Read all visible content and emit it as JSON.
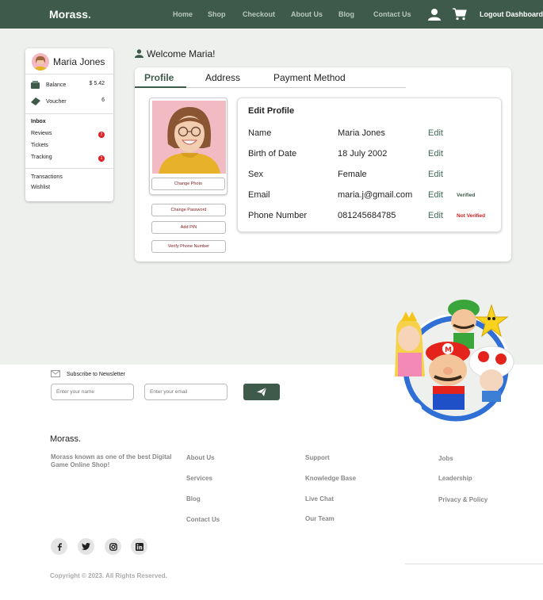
{
  "nav": {
    "logo": "Morass",
    "logo_dot": ".",
    "links": [
      "Home",
      "Shop",
      "Checkout",
      "About Us",
      "Blog",
      "Contact Us"
    ],
    "logout": "Logout Dashboard",
    "bg_color": "#3d5a4b"
  },
  "sidebar": {
    "user_name": "Maria Jones",
    "balance_label": "Balance",
    "balance_value": "$ 5.42",
    "voucher_label": "Voucher",
    "voucher_value": "6",
    "inbox_heading": "Inbox",
    "inbox_items": [
      {
        "label": "Reviews",
        "badge": "2"
      },
      {
        "label": "Tickets",
        "badge": ""
      },
      {
        "label": "Tracking",
        "badge": "1"
      }
    ],
    "other_items": [
      "Transactions",
      "Wishlist"
    ]
  },
  "welcome": "Welcome Maria!",
  "tabs": [
    {
      "label": "Profile",
      "active": true
    },
    {
      "label": "Address",
      "active": false
    },
    {
      "label": "Payment Method",
      "active": false
    }
  ],
  "photo_actions": {
    "change_photo": "Change Photo",
    "change_password": "Change Password",
    "add_pin": "Add PIN",
    "verify_phone": "Verify Phone Number"
  },
  "edit_profile": {
    "title": "Edit Profile",
    "edit_label": "Edit",
    "fields": [
      {
        "label": "Name",
        "value": "Maria Jones",
        "status": ""
      },
      {
        "label": "Birth of Date",
        "value": "18 July 2002",
        "status": ""
      },
      {
        "label": "Sex",
        "value": "Female",
        "status": ""
      },
      {
        "label": "Email",
        "value": "maria.j@gmail.com",
        "status": "Verified"
      },
      {
        "label": "Phone Number",
        "value": "081245684785",
        "status": "Not Verified"
      }
    ],
    "verified_color": "#3d5a4b",
    "not_verified_color": "#d81e1e"
  },
  "newsletter": {
    "label": "Subscribe to Newsletter",
    "name_placeholder": "Enter your name",
    "email_placeholder": "Enter your email"
  },
  "footer": {
    "brand": "Morass.",
    "description": "Morass known as one of the best Digital Game Online Shop!",
    "col1": [
      "About Us",
      "Services",
      "Blog",
      "Contact Us"
    ],
    "col2": [
      "Support",
      "Knowledge Base",
      "Live Chat",
      "Our Team"
    ],
    "col3": [
      "Jobs",
      "Leadership",
      "Privacy & Policy"
    ],
    "social": [
      "facebook-icon",
      "twitter-icon",
      "instagram-icon",
      "linkedin-icon"
    ],
    "copyright": "Copyright © 2023. All Rights Reserved."
  }
}
